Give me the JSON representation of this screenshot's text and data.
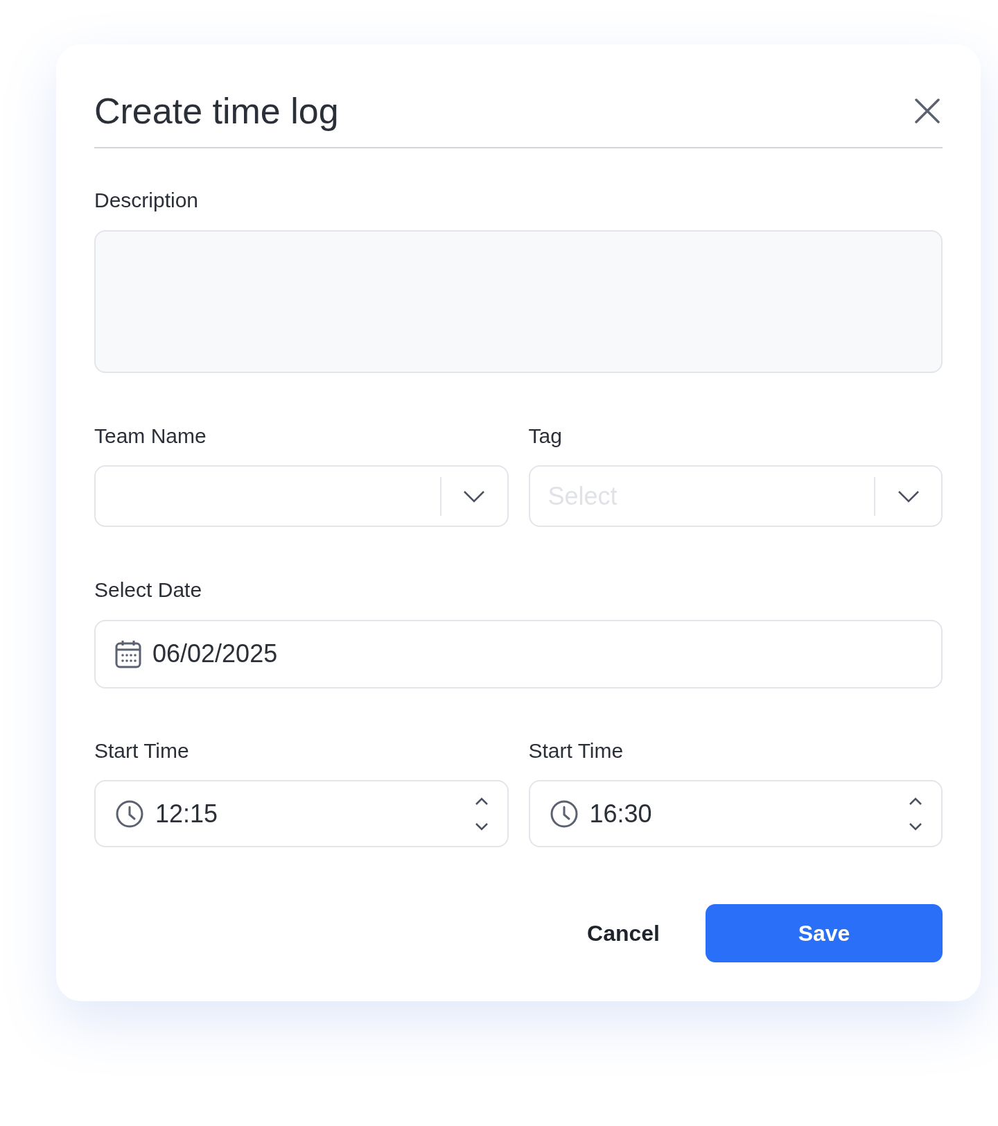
{
  "dialog": {
    "title": "Create time log"
  },
  "fields": [
    {
      "kind": "textarea",
      "label": "Description"
    },
    {
      "kind": "select",
      "label": "Team Name"
    },
    {
      "kind": "select",
      "label": "Tag",
      "placeholder": "Select"
    },
    {
      "kind": "date",
      "label": "Select Date",
      "value": "06/02/2025"
    },
    {
      "kind": "time",
      "label": "Start Time",
      "value": "12:15"
    },
    {
      "kind": "time",
      "label": "Start Time",
      "value": "16:30"
    }
  ],
  "buttons": [
    {
      "kind": "secondary",
      "label": "Cancel"
    },
    {
      "kind": "primary",
      "label": "Save"
    }
  ]
}
